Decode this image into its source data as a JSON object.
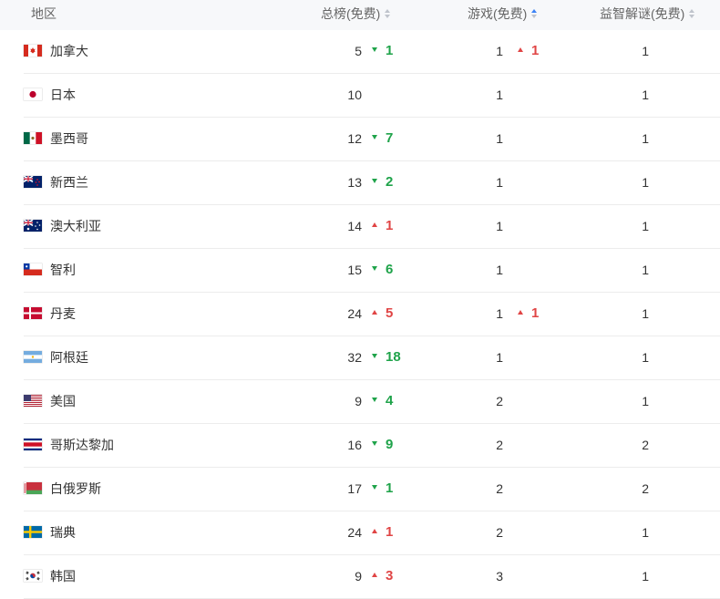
{
  "header": {
    "region": "地区",
    "total": "总榜(免费)",
    "games": "游戏(免费)",
    "puzzle": "益智解谜(免费)"
  },
  "colors": {
    "up": "#e04545",
    "down": "#1fa34a",
    "header_bg": "#f7f8fa",
    "sort_active": "#3b82f6",
    "sort_idle": "#c0c4cc"
  },
  "rows": [
    {
      "flag": "canada",
      "name": "加拿大",
      "total": "5",
      "total_dir": "down",
      "total_change": "1",
      "games": "1",
      "games_dir": "up",
      "games_change": "1",
      "puzzle": "1"
    },
    {
      "flag": "japan",
      "name": "日本",
      "total": "10",
      "total_dir": "",
      "total_change": "",
      "games": "1",
      "games_dir": "",
      "games_change": "",
      "puzzle": "1"
    },
    {
      "flag": "mexico",
      "name": "墨西哥",
      "total": "12",
      "total_dir": "down",
      "total_change": "7",
      "games": "1",
      "games_dir": "",
      "games_change": "",
      "puzzle": "1"
    },
    {
      "flag": "new-zealand",
      "name": "新西兰",
      "total": "13",
      "total_dir": "down",
      "total_change": "2",
      "games": "1",
      "games_dir": "",
      "games_change": "",
      "puzzle": "1"
    },
    {
      "flag": "australia",
      "name": "澳大利亚",
      "total": "14",
      "total_dir": "up",
      "total_change": "1",
      "games": "1",
      "games_dir": "",
      "games_change": "",
      "puzzle": "1"
    },
    {
      "flag": "chile",
      "name": "智利",
      "total": "15",
      "total_dir": "down",
      "total_change": "6",
      "games": "1",
      "games_dir": "",
      "games_change": "",
      "puzzle": "1"
    },
    {
      "flag": "denmark",
      "name": "丹麦",
      "total": "24",
      "total_dir": "up",
      "total_change": "5",
      "games": "1",
      "games_dir": "up",
      "games_change": "1",
      "puzzle": "1"
    },
    {
      "flag": "argentina",
      "name": "阿根廷",
      "total": "32",
      "total_dir": "down",
      "total_change": "18",
      "games": "1",
      "games_dir": "",
      "games_change": "",
      "puzzle": "1"
    },
    {
      "flag": "usa",
      "name": "美国",
      "total": "9",
      "total_dir": "down",
      "total_change": "4",
      "games": "2",
      "games_dir": "",
      "games_change": "",
      "puzzle": "1"
    },
    {
      "flag": "costa-rica",
      "name": "哥斯达黎加",
      "total": "16",
      "total_dir": "down",
      "total_change": "9",
      "games": "2",
      "games_dir": "",
      "games_change": "",
      "puzzle": "2"
    },
    {
      "flag": "belarus",
      "name": "白俄罗斯",
      "total": "17",
      "total_dir": "down",
      "total_change": "1",
      "games": "2",
      "games_dir": "",
      "games_change": "",
      "puzzle": "2"
    },
    {
      "flag": "sweden",
      "name": "瑞典",
      "total": "24",
      "total_dir": "up",
      "total_change": "1",
      "games": "2",
      "games_dir": "",
      "games_change": "",
      "puzzle": "1"
    },
    {
      "flag": "south-korea",
      "name": "韩国",
      "total": "9",
      "total_dir": "up",
      "total_change": "3",
      "games": "3",
      "games_dir": "",
      "games_change": "",
      "puzzle": "1"
    }
  ]
}
